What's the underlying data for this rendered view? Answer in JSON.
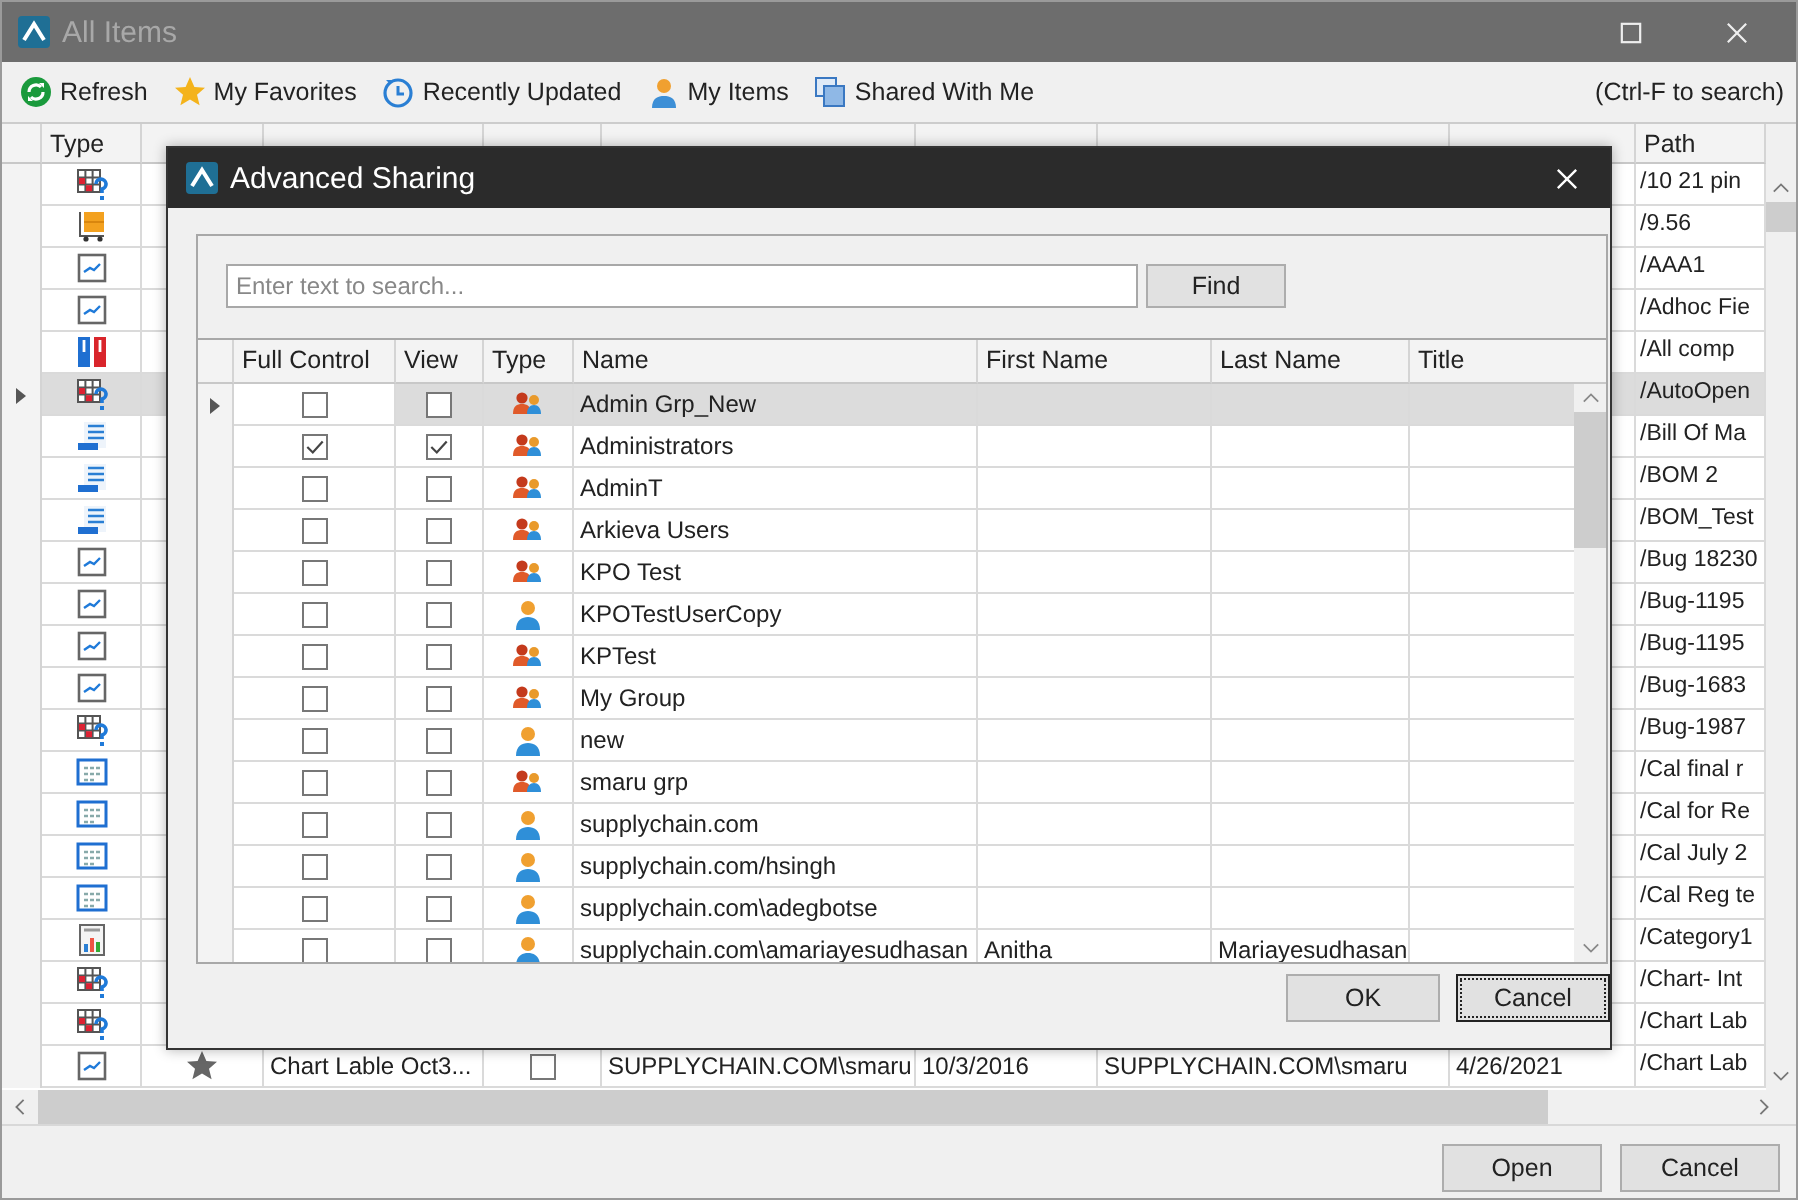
{
  "window": {
    "title": "All Items"
  },
  "toolbar": [
    {
      "kind": "refresh",
      "label": "Refresh"
    },
    {
      "kind": "star",
      "label": "My Favorites"
    },
    {
      "kind": "clock",
      "label": "Recently Updated"
    },
    {
      "kind": "person",
      "label": "My Items"
    },
    {
      "kind": "shared",
      "label": "Shared With Me"
    }
  ],
  "search_hint": "(Ctrl-F to search)",
  "grid": {
    "columns": {
      "type": "Type",
      "path": "Path"
    },
    "rows": [
      {
        "kind": "schedule",
        "path": "/10 21 pin",
        "selected": false
      },
      {
        "kind": "cart",
        "path": "/9.56",
        "selected": false
      },
      {
        "kind": "chart",
        "path": "/AAA1",
        "selected": false
      },
      {
        "kind": "chart",
        "path": "/Adhoc Fie",
        "selected": false
      },
      {
        "kind": "binder",
        "path": "/All  comp",
        "selected": false
      },
      {
        "kind": "schedule",
        "path": "/AutoOpen",
        "selected": true
      },
      {
        "kind": "list",
        "path": "/Bill Of Ma",
        "selected": false
      },
      {
        "kind": "list",
        "path": "/BOM 2",
        "selected": false
      },
      {
        "kind": "list",
        "path": "/BOM_Test",
        "selected": false
      },
      {
        "kind": "chart",
        "path": "/Bug 18230",
        "selected": false
      },
      {
        "kind": "chart",
        "path": "/Bug-1195",
        "selected": false
      },
      {
        "kind": "chart",
        "path": "/Bug-1195",
        "selected": false
      },
      {
        "kind": "chart",
        "path": "/Bug-1683",
        "selected": false
      },
      {
        "kind": "schedule",
        "path": "/Bug-1987",
        "selected": false
      },
      {
        "kind": "calendar",
        "path": "/Cal final r",
        "selected": false
      },
      {
        "kind": "calendar",
        "path": "/Cal for Re",
        "selected": false
      },
      {
        "kind": "calendar",
        "path": "/Cal July 2",
        "selected": false
      },
      {
        "kind": "calendar",
        "path": "/Cal Reg te",
        "selected": false
      },
      {
        "kind": "report",
        "path": "/Category1",
        "selected": false
      },
      {
        "kind": "schedule",
        "path": "/Chart- Int",
        "selected": false
      },
      {
        "kind": "schedule",
        "path": "/Chart Lab",
        "selected": false
      },
      {
        "kind": "chart",
        "favorite": true,
        "name": "Chart Lable Oct3...",
        "hidden": false,
        "created_by": "SUPPLYCHAIN.COM\\smaru",
        "creation_date": "10/3/2016",
        "updated_by": "SUPPLYCHAIN.COM\\smaru",
        "updated_date": "4/26/2021",
        "path": "/Chart Lab",
        "selected": false
      }
    ]
  },
  "dialog": {
    "title": "Advanced Sharing",
    "search": {
      "placeholder": "Enter text to search..."
    },
    "find_button": "Find",
    "columns": [
      "Full Control",
      "View",
      "Type",
      "Name",
      "First Name",
      "Last Name",
      "Title"
    ],
    "rows": [
      {
        "full_control": false,
        "view": false,
        "kind": "group",
        "name": "Admin Grp_New",
        "selected": true
      },
      {
        "full_control": true,
        "view": true,
        "kind": "group",
        "name": "Administrators",
        "selected": false
      },
      {
        "full_control": false,
        "view": false,
        "kind": "group",
        "name": "AdminT",
        "selected": false
      },
      {
        "full_control": false,
        "view": false,
        "kind": "group",
        "name": "Arkieva Users",
        "selected": false
      },
      {
        "full_control": false,
        "view": false,
        "kind": "group",
        "name": "KPO Test",
        "selected": false
      },
      {
        "full_control": false,
        "view": false,
        "kind": "user",
        "name": "KPOTestUserCopy",
        "selected": false
      },
      {
        "full_control": false,
        "view": false,
        "kind": "group",
        "name": "KPTest",
        "selected": false
      },
      {
        "full_control": false,
        "view": false,
        "kind": "group",
        "name": "My Group",
        "selected": false
      },
      {
        "full_control": false,
        "view": false,
        "kind": "user",
        "name": "new",
        "selected": false
      },
      {
        "full_control": false,
        "view": false,
        "kind": "group",
        "name": "smaru grp",
        "selected": false
      },
      {
        "full_control": false,
        "view": false,
        "kind": "user",
        "name": "supplychain.com",
        "selected": false
      },
      {
        "full_control": false,
        "view": false,
        "kind": "user",
        "name": "supplychain.com/hsingh",
        "selected": false
      },
      {
        "full_control": false,
        "view": false,
        "kind": "user",
        "name": "supplychain.com\\adegbotse",
        "selected": false
      },
      {
        "full_control": false,
        "view": false,
        "kind": "user",
        "name": "supplychain.com\\amariayesudhasan",
        "first_name": "Anitha",
        "last_name": "Mariayesudhasan",
        "selected": false
      }
    ],
    "buttons": [
      "OK",
      "Cancel"
    ]
  },
  "buttons": [
    "Open",
    "Cancel"
  ]
}
